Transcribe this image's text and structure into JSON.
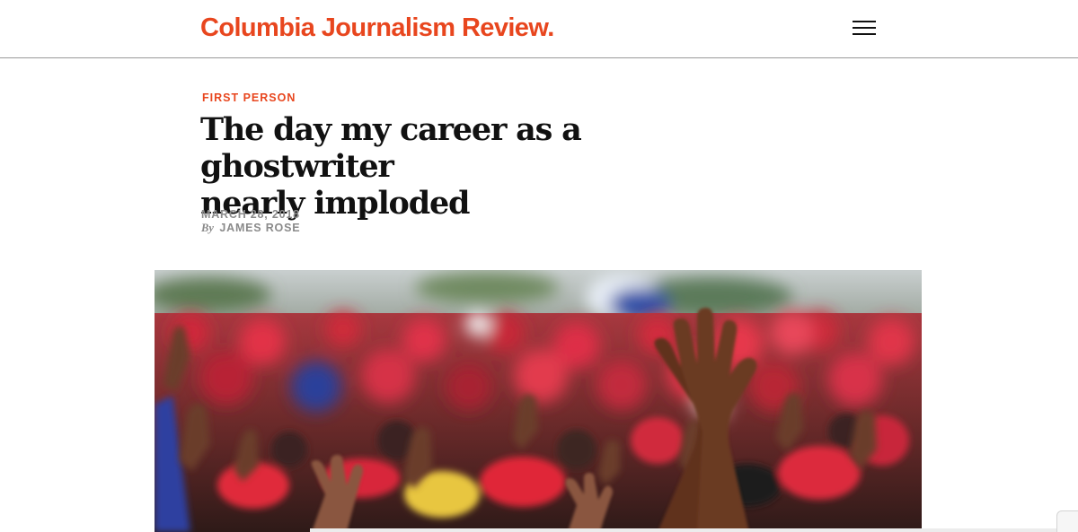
{
  "header": {
    "logo_text": "Columbia Journalism Review.",
    "menu_icon": "hamburger-menu-icon"
  },
  "article": {
    "kicker": "FIRST PERSON",
    "headline_line1": "The day my career as a ghostwriter",
    "headline_line2": "nearly imploded",
    "date": "MARCH 28, 2018",
    "byline_prefix": "By",
    "author": "JAMES ROSE"
  },
  "colors": {
    "brand": "#e8461e",
    "text": "#111111",
    "meta": "#8a8a8a"
  }
}
